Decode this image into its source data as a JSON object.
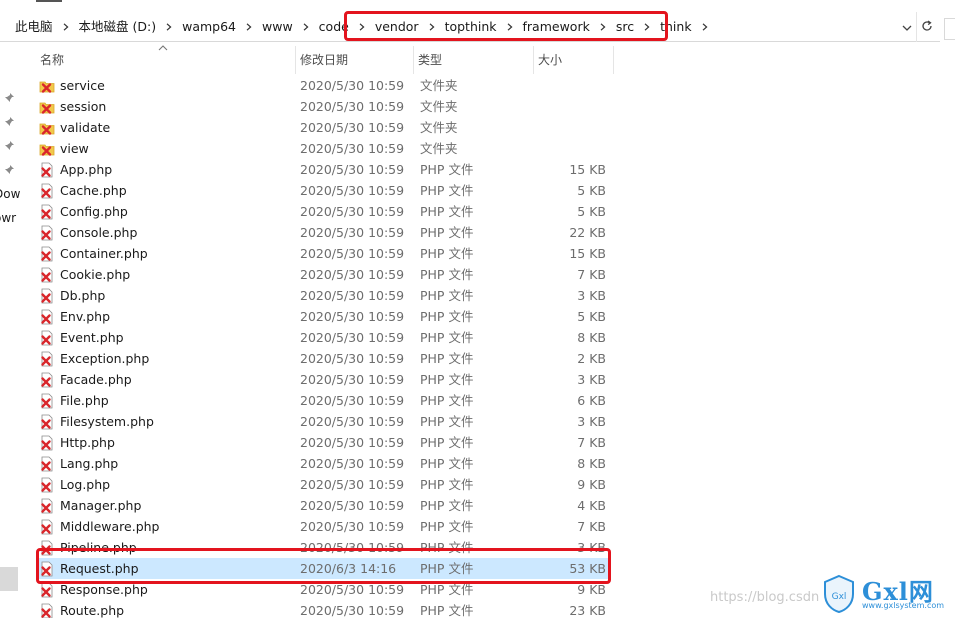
{
  "breadcrumb": {
    "items": [
      "此电脑",
      "本地磁盘 (D:)",
      "wamp64",
      "www",
      "code",
      "vendor",
      "topthink",
      "framework",
      "src",
      "think"
    ]
  },
  "nav": {
    "fragments": [
      "Dow",
      "owr"
    ]
  },
  "columns": {
    "name": "名称",
    "date": "修改日期",
    "type": "类型",
    "size": "大小"
  },
  "files": [
    {
      "name": "service",
      "date": "2020/5/30 10:59",
      "type": "文件夹",
      "size": "",
      "kind": "folder"
    },
    {
      "name": "session",
      "date": "2020/5/30 10:59",
      "type": "文件夹",
      "size": "",
      "kind": "folder"
    },
    {
      "name": "validate",
      "date": "2020/5/30 10:59",
      "type": "文件夹",
      "size": "",
      "kind": "folder"
    },
    {
      "name": "view",
      "date": "2020/5/30 10:59",
      "type": "文件夹",
      "size": "",
      "kind": "folder"
    },
    {
      "name": "App.php",
      "date": "2020/5/30 10:59",
      "type": "PHP 文件",
      "size": "15 KB",
      "kind": "file"
    },
    {
      "name": "Cache.php",
      "date": "2020/5/30 10:59",
      "type": "PHP 文件",
      "size": "5 KB",
      "kind": "file"
    },
    {
      "name": "Config.php",
      "date": "2020/5/30 10:59",
      "type": "PHP 文件",
      "size": "5 KB",
      "kind": "file"
    },
    {
      "name": "Console.php",
      "date": "2020/5/30 10:59",
      "type": "PHP 文件",
      "size": "22 KB",
      "kind": "file"
    },
    {
      "name": "Container.php",
      "date": "2020/5/30 10:59",
      "type": "PHP 文件",
      "size": "15 KB",
      "kind": "file"
    },
    {
      "name": "Cookie.php",
      "date": "2020/5/30 10:59",
      "type": "PHP 文件",
      "size": "7 KB",
      "kind": "file"
    },
    {
      "name": "Db.php",
      "date": "2020/5/30 10:59",
      "type": "PHP 文件",
      "size": "3 KB",
      "kind": "file"
    },
    {
      "name": "Env.php",
      "date": "2020/5/30 10:59",
      "type": "PHP 文件",
      "size": "5 KB",
      "kind": "file"
    },
    {
      "name": "Event.php",
      "date": "2020/5/30 10:59",
      "type": "PHP 文件",
      "size": "8 KB",
      "kind": "file"
    },
    {
      "name": "Exception.php",
      "date": "2020/5/30 10:59",
      "type": "PHP 文件",
      "size": "2 KB",
      "kind": "file"
    },
    {
      "name": "Facade.php",
      "date": "2020/5/30 10:59",
      "type": "PHP 文件",
      "size": "3 KB",
      "kind": "file"
    },
    {
      "name": "File.php",
      "date": "2020/5/30 10:59",
      "type": "PHP 文件",
      "size": "6 KB",
      "kind": "file"
    },
    {
      "name": "Filesystem.php",
      "date": "2020/5/30 10:59",
      "type": "PHP 文件",
      "size": "3 KB",
      "kind": "file"
    },
    {
      "name": "Http.php",
      "date": "2020/5/30 10:59",
      "type": "PHP 文件",
      "size": "7 KB",
      "kind": "file"
    },
    {
      "name": "Lang.php",
      "date": "2020/5/30 10:59",
      "type": "PHP 文件",
      "size": "8 KB",
      "kind": "file"
    },
    {
      "name": "Log.php",
      "date": "2020/5/30 10:59",
      "type": "PHP 文件",
      "size": "9 KB",
      "kind": "file"
    },
    {
      "name": "Manager.php",
      "date": "2020/5/30 10:59",
      "type": "PHP 文件",
      "size": "4 KB",
      "kind": "file"
    },
    {
      "name": "Middleware.php",
      "date": "2020/5/30 10:59",
      "type": "PHP 文件",
      "size": "7 KB",
      "kind": "file"
    },
    {
      "name": "Pipeline.php",
      "date": "2020/5/30 10:59",
      "type": "PHP 文件",
      "size": "3 KB",
      "kind": "file"
    },
    {
      "name": "Request.php",
      "date": "2020/6/3 14:16",
      "type": "PHP 文件",
      "size": "53 KB",
      "kind": "file",
      "selected": true
    },
    {
      "name": "Response.php",
      "date": "2020/5/30 10:59",
      "type": "PHP 文件",
      "size": "9 KB",
      "kind": "file"
    },
    {
      "name": "Route.php",
      "date": "2020/5/30 10:59",
      "type": "PHP 文件",
      "size": "23 KB",
      "kind": "file"
    }
  ],
  "watermark": {
    "blog_text": "https://blog.csdn",
    "brand": "Gxl",
    "brand_glyph": "网",
    "domain": "www.gxlsystem.com"
  },
  "colors": {
    "highlight_border": "#e3141e",
    "selected_row": "#cce8ff",
    "icon_x": "#d9262b",
    "folder": "#f2c84b",
    "watermark_blue": "#2d8fd8"
  }
}
